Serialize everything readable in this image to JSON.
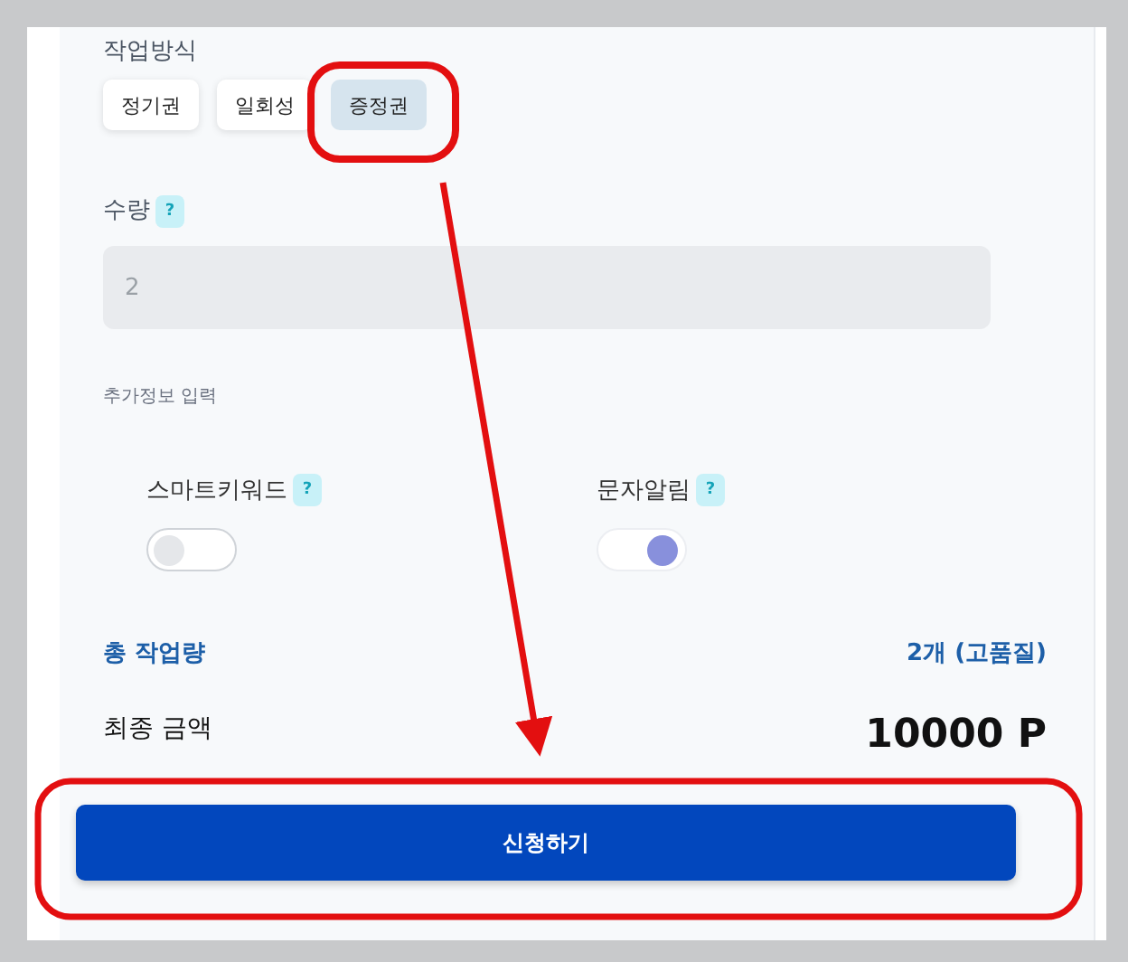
{
  "work_method": {
    "label": "작업방식",
    "options": [
      {
        "label": "정기권",
        "selected": false
      },
      {
        "label": "일회성",
        "selected": false
      },
      {
        "label": "증정권",
        "selected": true
      }
    ]
  },
  "quantity": {
    "label": "수량",
    "help": "?",
    "value": "2",
    "disabled": true
  },
  "extra_info": {
    "label": "추가정보 입력",
    "toggles": [
      {
        "label": "스마트키워드",
        "help": "?",
        "on": false
      },
      {
        "label": "문자알림",
        "help": "?",
        "on": true
      }
    ]
  },
  "total": {
    "label": "총 작업량",
    "value": "2개 (고품질)"
  },
  "final_price": {
    "label": "최종 금액",
    "value": "10000 P"
  },
  "submit_button": "신청하기"
}
